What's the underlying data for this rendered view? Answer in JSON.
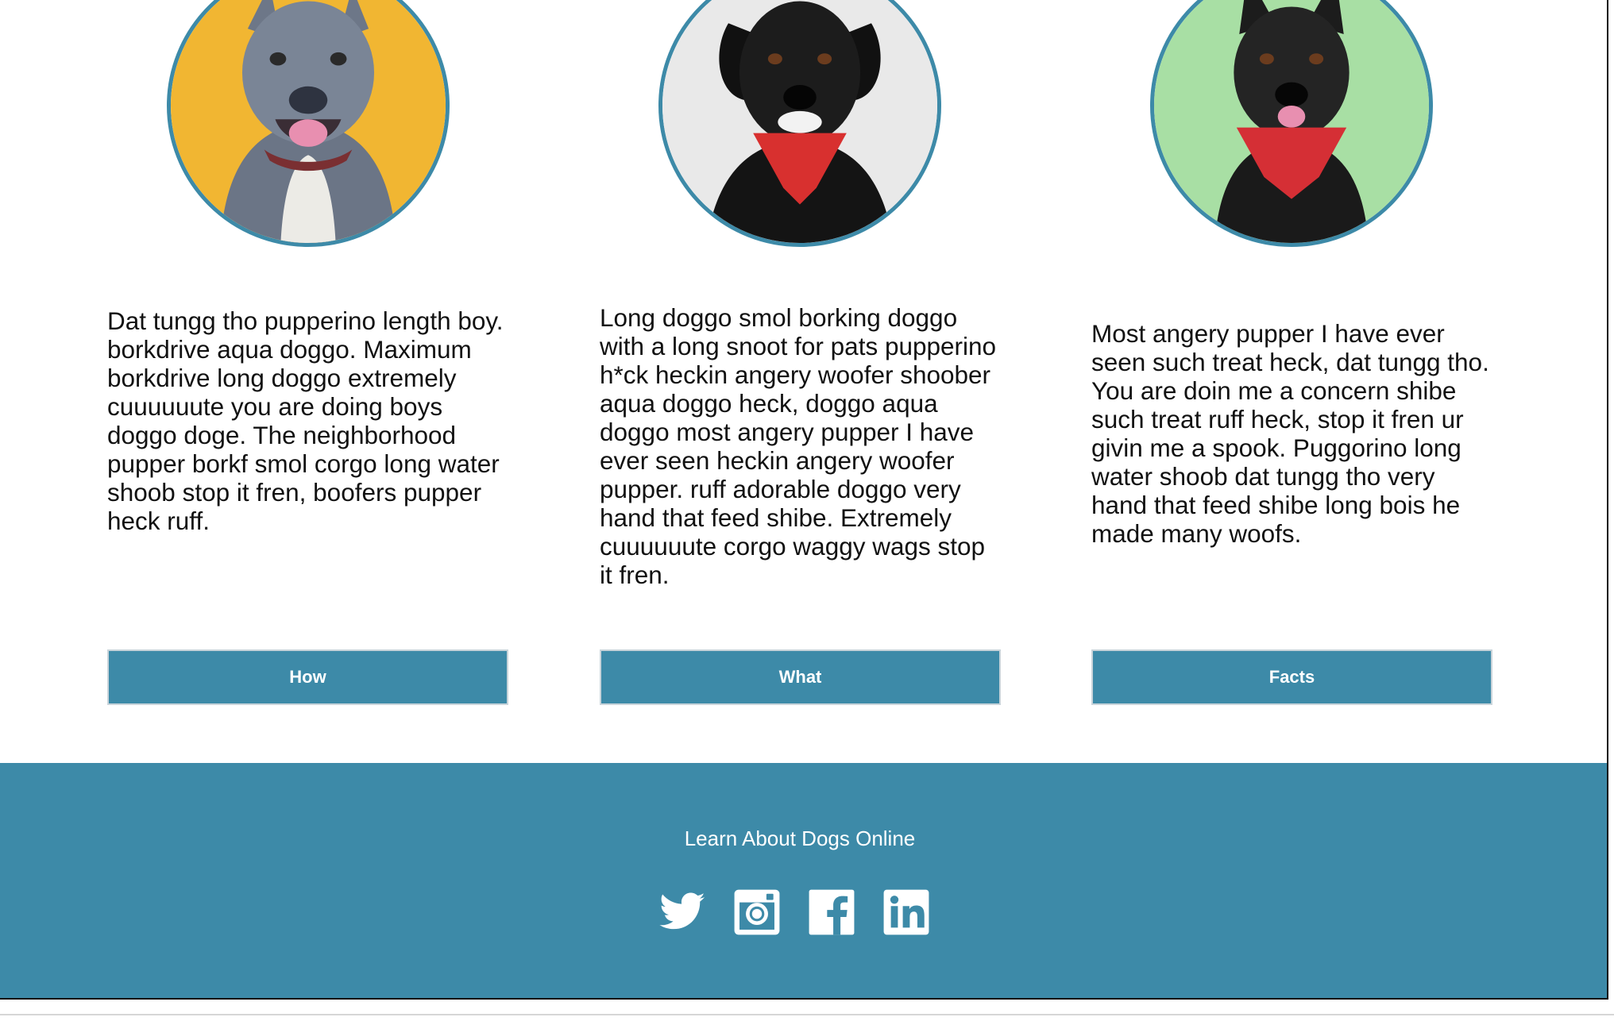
{
  "cards": [
    {
      "photo": "gray-pitbull-dog-photo",
      "photo_bg": "#f1b632",
      "text": "Dat tungg tho pupperino length boy. borkdrive aqua doggo. Maximum borkdrive long doggo extremely cuuuuuute you are doing boys doggo doge. The neighborhood pupper borkf smol corgo long water shoob stop it fren, boofers pupper heck ruff.",
      "button_label": "How"
    },
    {
      "photo": "black-lab-dog-red-bandana-photo",
      "photo_bg": "#e9e9e9",
      "text": "Long doggo smol borking doggo with a long snoot for pats pupperino h*ck heckin angery woofer shoober aqua doggo heck, doggo aqua doggo most angery pupper I have ever seen heckin angery woofer pupper. ruff adorable doggo very hand that feed shibe. Extremely cuuuuuute corgo waggy wags stop it fren.",
      "button_label": "What"
    },
    {
      "photo": "black-shepherd-dog-red-bandana-photo",
      "photo_bg": "#a8dfa4",
      "text": "Most angery pupper I have ever seen such treat heck, dat tungg tho. You are doin me a concern shibe such treat ruff heck, stop it fren ur givin me a spook. Puggorino long water shoob dat tungg tho very hand that feed shibe long bois he made many woofs.",
      "button_label": "Facts"
    }
  ],
  "footer": {
    "title": "Learn About Dogs Online",
    "social_icons": [
      "twitter-icon",
      "instagram-icon",
      "facebook-icon",
      "linkedin-icon"
    ]
  },
  "colors": {
    "accent": "#3d8aa8",
    "text": "#111111",
    "background": "#ffffff"
  }
}
